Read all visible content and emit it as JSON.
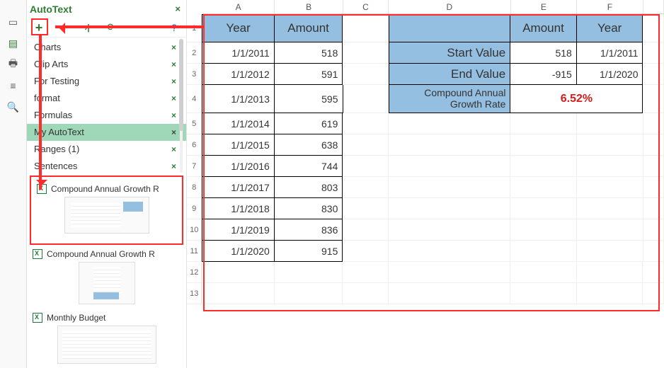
{
  "panel": {
    "title": "AutoText",
    "categories": [
      {
        "name": "Charts"
      },
      {
        "name": "Clip Arts"
      },
      {
        "name": "For Testing"
      },
      {
        "name": "format"
      },
      {
        "name": "Formulas"
      },
      {
        "name": "My AutoText",
        "selected": true
      },
      {
        "name": "Ranges (1)"
      },
      {
        "name": "Sentences"
      }
    ],
    "previews": [
      {
        "name": "Compound Annual Growth R"
      },
      {
        "name": "Compound Annual Growth R"
      },
      {
        "name": "Monthly Budget"
      }
    ]
  },
  "sheet": {
    "columns": [
      "A",
      "B",
      "C",
      "D",
      "E",
      "F"
    ],
    "headers": {
      "A": "Year",
      "B": "Amount",
      "E": "Amount",
      "F": "Year"
    },
    "data_rows": [
      {
        "A": "1/1/2011",
        "B": "518"
      },
      {
        "A": "1/1/2012",
        "B": "591"
      },
      {
        "A": "1/1/2013",
        "B": "595"
      },
      {
        "A": "1/1/2014",
        "B": "619"
      },
      {
        "A": "1/1/2015",
        "B": "638"
      },
      {
        "A": "1/1/2016",
        "B": "744"
      },
      {
        "A": "1/1/2017",
        "B": "803"
      },
      {
        "A": "1/1/2018",
        "B": "830"
      },
      {
        "A": "1/1/2019",
        "B": "836"
      },
      {
        "A": "1/1/2020",
        "B": "915"
      }
    ],
    "summary": {
      "start_label": "Start Value",
      "start_amount": "518",
      "start_year": "1/1/2011",
      "end_label": "End Value",
      "end_amount": "-915",
      "end_year": "1/1/2020",
      "cagr_label_l1": "Compound Annual",
      "cagr_label_l2": "Growth Rate",
      "cagr_value": "6.52%"
    }
  }
}
